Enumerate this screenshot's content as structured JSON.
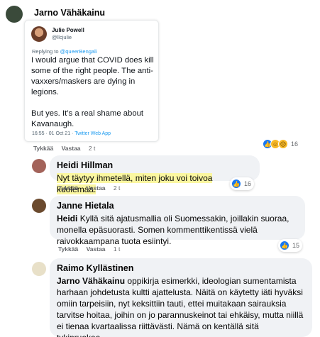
{
  "comments": [
    {
      "author": "Jarno Vähäkainu",
      "tweet": {
        "name": "Julie Powell",
        "handle": "@llcjulie",
        "reply_prefix": "Replying to",
        "reply_to": "@queerBengali",
        "paragraph1": "I would argue that COVID does kill some of the right people. The anti-vaxxers/maskers are dying in legions.",
        "paragraph2": "But yes. It’s a real shame about Kavanaugh.",
        "time": "16:55 · 01 Oct 21 ·",
        "source": "Twitter Web App"
      },
      "like_label": "Tykkää",
      "reply_label": "Vastaa",
      "time": "2 t",
      "reaction_count": "16",
      "reactions": [
        "like-icon",
        "care-icon",
        "wow-icon"
      ]
    },
    {
      "author": "Heidi Hillman",
      "text": "Nyt täytyy ihmetellä, miten joku voi toivoa kuolemaa.",
      "like_label": "Tykkää",
      "reply_label": "Vastaa",
      "time": "2 t",
      "reaction_count": "16",
      "reactions": [
        "like-icon"
      ]
    },
    {
      "author": "Janne Hietala",
      "tag": "Heidi",
      "text": "Kyllä sitä ajatusmallia oli Suomessakin, joillakin suoraa, monella epäsuorasti. Somen kommenttikentissä vielä raivokkaampana tuota esiintyi.",
      "like_label": "Tykkää",
      "reply_label": "Vastaa",
      "time": "1 t",
      "reaction_count": "15",
      "reactions": [
        "like-icon"
      ]
    },
    {
      "author": "Raimo Kyllästinen",
      "tag": "Jarno Vähäkainu",
      "text": "oppikirja esimerkki, ideologian sumentamista harhaan johdetusta kultti ajattelusta. Näitä on käytetty iäti hyväksi omiin tarpeisiin, nyt keksittiin tauti, ettei muitakaan sairauksia tarvitse hoitaa, joihin on jo parannuskeinot tai ehkäisy, mutta niillä ei tienaa kvartaalissa riittävästi. Nämä on kentällä sitä tykinruokaa."
    }
  ],
  "colors": {
    "bubble": "#f0f2f5",
    "highlight": "#fbf7a0",
    "like": "#1877f2",
    "twitter_link": "#1d9bf0"
  }
}
